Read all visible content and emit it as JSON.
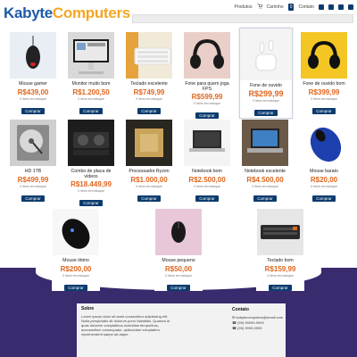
{
  "header": {
    "logo_part1": "Kabyte",
    "logo_part2": "Computers",
    "nav": {
      "products": "Produtos",
      "cart": "Carrinho",
      "cart_count": "0",
      "contact": "Contato"
    }
  },
  "products": [
    {
      "name": "Mouse gamer",
      "price": "R$439,00",
      "stock": "X itens em estoque",
      "buy": "Comprar"
    },
    {
      "name": "Monitor muito bom",
      "price": "R$1.200,50",
      "stock": "X itens em estoque",
      "buy": "Comprar"
    },
    {
      "name": "Teclado excelente",
      "price": "R$749,99",
      "stock": "X itens em estoque",
      "buy": "Comprar"
    },
    {
      "name": "Fone para quem joga FPS",
      "price": "R$599,99",
      "stock": "X itens em estoque",
      "buy": "Comprar"
    },
    {
      "name": "Fone de ouvido",
      "price": "R$299,99",
      "stock": "X itens em estoque",
      "buy": "Comprar"
    },
    {
      "name": "Fone de ouvido bom",
      "price": "R$399,99",
      "stock": "X itens em estoque",
      "buy": "Comprar"
    },
    {
      "name": "HD 1TB",
      "price": "R$499,99",
      "stock": "X itens em estoque",
      "buy": "Comprar"
    },
    {
      "name": "Combo de placa de vídeos",
      "price": "R$18.449,99",
      "stock": "X itens em estoque",
      "buy": "Comprar"
    },
    {
      "name": "Processador Ryzen",
      "price": "R$1.000,00",
      "stock": "X itens em estoque",
      "buy": "Comprar"
    },
    {
      "name": "Notebook bom",
      "price": "R$2.500,00",
      "stock": "X itens em estoque",
      "buy": "Comprar"
    },
    {
      "name": "Notebook excelente",
      "price": "R$4.500,00",
      "stock": "X itens em estoque",
      "buy": "Comprar"
    },
    {
      "name": "Mouse barato",
      "price": "R$20,00",
      "stock": "X itens em estoque",
      "buy": "Comprar"
    },
    {
      "name": "Mouse ótimo",
      "price": "R$200,00",
      "stock": "X itens em estoque",
      "buy": "Comprar"
    },
    {
      "name": "Mouse pequeno",
      "price": "R$50,00",
      "stock": "X itens em estoque",
      "buy": "Comprar"
    },
    {
      "name": "Teclado bom",
      "price": "R$159,99",
      "stock": "X itens em estoque",
      "buy": "Comprar"
    }
  ],
  "footer": {
    "about_title": "Sobre",
    "about_text": "Lorem ipsum dolor sit amet consectetur adipisicing elit. Nulla perspiciatis sit dolorum porro blanditiis. Quaerat id quas dolorem voluptatibus molestiae temporibus, accusantium consequatur, quibusdam voluptatem reprehenderit saepe ad atque.",
    "contact_title": "Contato",
    "email": "kabytecomputers@email.com",
    "phone1": "(99) 99999-9999",
    "phone2": "(99) 9999-9999"
  },
  "colors": {
    "brand_blue": "#1e5aa8",
    "brand_orange": "#f5a623",
    "price": "#e0661f",
    "button": "#0b3b6e",
    "background_purple": "#3a2a6e"
  }
}
